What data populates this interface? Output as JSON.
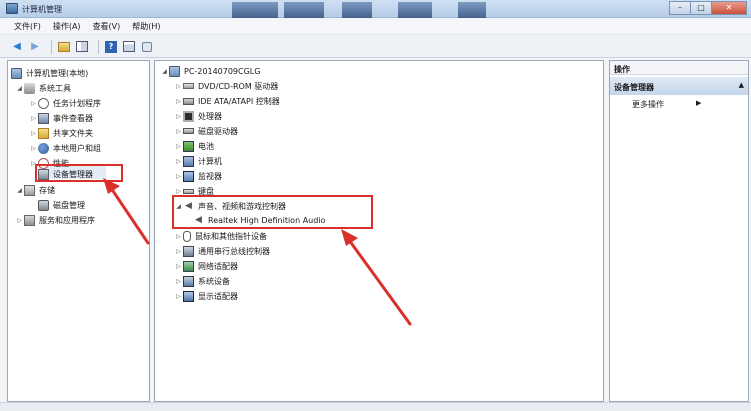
{
  "window": {
    "title": "计算机管理"
  },
  "menu": {
    "items": [
      "文件(F)",
      "操作(A)",
      "查看(V)",
      "帮助(H)"
    ]
  },
  "toolbar": {
    "buttons": [
      "back-arrow-icon",
      "forward-arrow-icon",
      "up-folder-icon",
      "show-hide-tree-icon",
      "help-icon",
      "properties-icon",
      "refresh-icon"
    ]
  },
  "left_tree": {
    "root": "计算机管理(本地)",
    "system_tools": "系统工具",
    "task_scheduler": "任务计划程序",
    "event_viewer": "事件查看器",
    "shared_folders": "共享文件夹",
    "local_users": "本地用户和组",
    "performance": "性能",
    "device_manager": "设备管理器",
    "storage": "存储",
    "disk_management": "磁盘管理",
    "services": "服务和应用程序"
  },
  "device_tree": {
    "computer": "PC-20140709CGLG",
    "categories": {
      "dvd": "DVD/CD-ROM 驱动器",
      "ide": "IDE ATA/ATAPI 控制器",
      "cpu": "处理器",
      "disk": "磁盘驱动器",
      "battery": "电池",
      "computer": "计算机",
      "monitor": "监视器",
      "keyboard": "键盘",
      "sound": "声音、视频和游戏控制器",
      "sound_device": "Realtek High Definition Audio",
      "mouse": "鼠标和其他指针设备",
      "usb": "通用串行总线控制器",
      "network": "网络适配器",
      "system": "系统设备",
      "display": "显示适配器"
    }
  },
  "actions_pane": {
    "header": "操作",
    "section": "设备管理器",
    "more": "更多操作"
  },
  "colors": {
    "annotation": "#d9302c",
    "selection": "#e3ecf7"
  }
}
